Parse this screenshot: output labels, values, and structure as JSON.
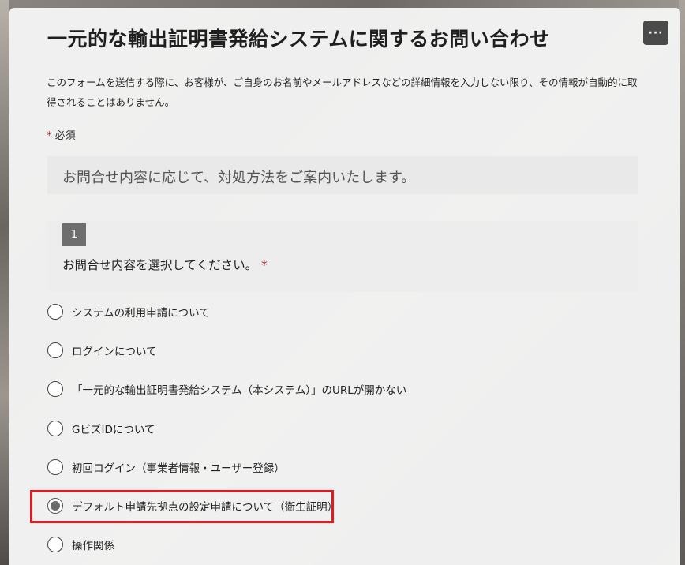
{
  "form": {
    "title": "一元的な輸出証明書発給システムに関するお問い合わせ",
    "more_button_label": "···",
    "notice": "このフォームを送信する際に、お客様が、ご自身のお名前やメールアドレスなどの詳細情報を入力しない限り、その情報が自動的に取得されることはありません。",
    "required_star": "*",
    "required_label": "必須",
    "intro": "お問合せ内容に応じて、対処方法をご案内いたします。"
  },
  "question": {
    "number": "1",
    "label": "お問合せ内容を選択してください。",
    "required_star": "*",
    "options": [
      {
        "label": "システムの利用申請について",
        "selected": false
      },
      {
        "label": "ログインについて",
        "selected": false
      },
      {
        "label": "「一元的な輸出証明書発給システム（本システム）」のURLが開かない",
        "selected": false
      },
      {
        "label": "GビズIDについて",
        "selected": false
      },
      {
        "label": "初回ログイン（事業者情報・ユーザー登録）",
        "selected": false
      },
      {
        "label": "デフォルト申請先拠点の設定申請について（衛生証明）",
        "selected": true
      },
      {
        "label": "操作関係",
        "selected": false
      }
    ]
  },
  "colors": {
    "highlight_border": "#e01a22",
    "required_star": "#a4262c",
    "question_number_bg": "#6e6e6e"
  }
}
